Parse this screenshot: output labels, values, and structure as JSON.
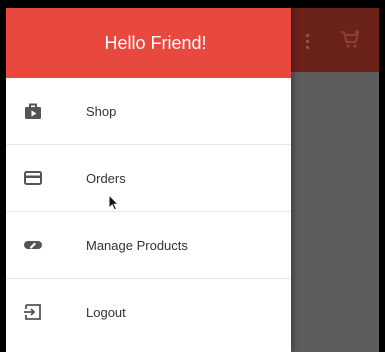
{
  "drawer": {
    "title": "Hello Friend!",
    "items": [
      {
        "label": "Shop",
        "icon": "shop-icon"
      },
      {
        "label": "Orders",
        "icon": "credit-card-icon"
      },
      {
        "label": "Manage Products",
        "icon": "edit-icon"
      },
      {
        "label": "Logout",
        "icon": "logout-icon"
      }
    ]
  },
  "colors": {
    "header": "#e8483d",
    "appbar_dimmed": "#6a2219",
    "scrim": "#5d5d5d",
    "icon": "#555555"
  }
}
